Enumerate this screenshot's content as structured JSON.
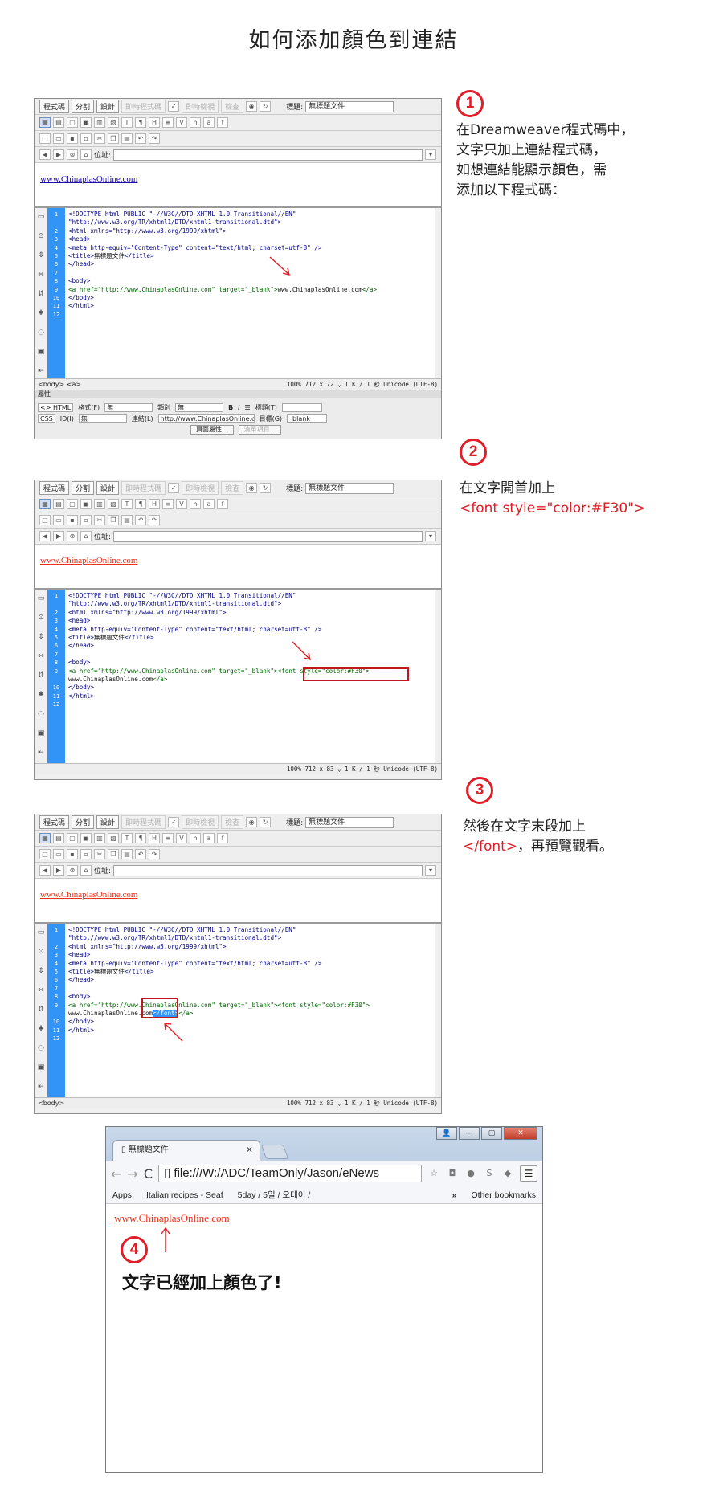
{
  "page_title": "如何添加顏色到連結",
  "dw": {
    "btn_code": "程式碼",
    "btn_split": "分割",
    "btn_design": "設計",
    "btn_live_code": "即時程式碼",
    "btn_live_view": "即時檢視",
    "btn_inspect": "檢查",
    "title_label": "標題:",
    "title_value": "無標題文件",
    "address_label": "位址:",
    "link_text": "www.ChinaplasOnline.com",
    "line_numbers": [
      "1",
      "",
      "2",
      "3",
      "4",
      "5",
      "6",
      "7",
      "8",
      "9",
      "10",
      "11",
      "12"
    ],
    "status_tag_1": "<body> <a>",
    "status_tag": "<body>",
    "zoom": "100%",
    "status_info_1": "712 x 72 ⌄ 1 K / 1 秒 Unicode (UTF-8)",
    "status_info_2": "712 x 83 ⌄ 1 K / 1 秒 Unicode (UTF-8)",
    "props": {
      "header": "屬性",
      "html_btn": "<> HTML",
      "css_btn": "CSS",
      "format_label": "格式(F)",
      "format_value": "無",
      "class_label": "類別",
      "class_value": "無",
      "id_label": "ID(I)",
      "id_value": "無",
      "link_label": "連結(L)",
      "link_value": "http://www.ChinaplasOnline.co",
      "title_label": "標題(T)",
      "target_label": "目標(G)",
      "target_value": "_blank",
      "page_props": "頁面屬性...",
      "list_item": "清單項目..."
    }
  },
  "code1": {
    "l1": "<!DOCTYPE html PUBLIC \"-//W3C//DTD XHTML 1.0 Transitional//EN\"",
    "l1b": "\"http://www.w3.org/TR/xhtml1/DTD/xhtml1-transitional.dtd\">",
    "l2": "<html xmlns=\"http://www.w3.org/1999/xhtml\">",
    "l3": "<head>",
    "l4": "<meta http-equiv=\"Content-Type\" content=\"text/html; charset=utf-8\" />",
    "l5a": "<title>",
    "l5b": "無標題文件",
    "l5c": "</title>",
    "l6": "</head>",
    "l8": "<body>",
    "l9a": "<a href=\"http://www.ChinaplasOnline.com\" target=\"_blank\">",
    "l9b": "www.ChinaplasOnline.com",
    "l9c": "</a>",
    "l10": "</body>",
    "l11": "</html>"
  },
  "code2": {
    "l9a": "<a href=\"http://www.ChinaplasOnline.com\" target=\"_blank\">",
    "l9font": "<font style=\"color:#F30\">",
    "l9d": "www.ChinaplasOnline.com",
    "l9e": "</a>"
  },
  "code3": {
    "l9a": "<a href=\"http://www.Chi",
    "l9a2": "naplasOnl",
    "l9a3": "ine.com\" target=\"_blank\"><font style=\"color:#F30\">",
    "l9d": "www.ChinaplasOnline.co",
    "l9d2": "m",
    "l9close": "</font>",
    "l9e": "</a>"
  },
  "steps": [
    {
      "num": "1",
      "text_lines": [
        "在Dreamweaver程式碼中，",
        "文字只加上連結程式碼，",
        "如想連結能顯示顏色，需",
        "添加以下程式碼："
      ]
    },
    {
      "num": "2",
      "text_line": "在文字開首加上",
      "code": "<font style=\"color:#F30\">"
    },
    {
      "num": "3",
      "text_line": "然後在文字末段加上",
      "code": "</font>",
      "text_tail": "，再預覽觀看。"
    },
    {
      "num": "4",
      "text": "文字已經加上顏色了!"
    }
  ],
  "browser": {
    "tab_title": "無標題文件",
    "url": "file:///W:/ADC/TeamOnly/Jason/eNews",
    "bookmarks": [
      "Apps",
      "Italian recipes - Seaf",
      "5day / 5일 / 오데이 /"
    ],
    "other_bookmarks": "Other bookmarks",
    "link_text": "www.ChinaplasOnline.com"
  },
  "colors": {
    "accent_red": "#e11d27",
    "link_orange": "#e8321a",
    "link_blue": "#1a0dab",
    "gutter_blue": "#3394f8"
  }
}
